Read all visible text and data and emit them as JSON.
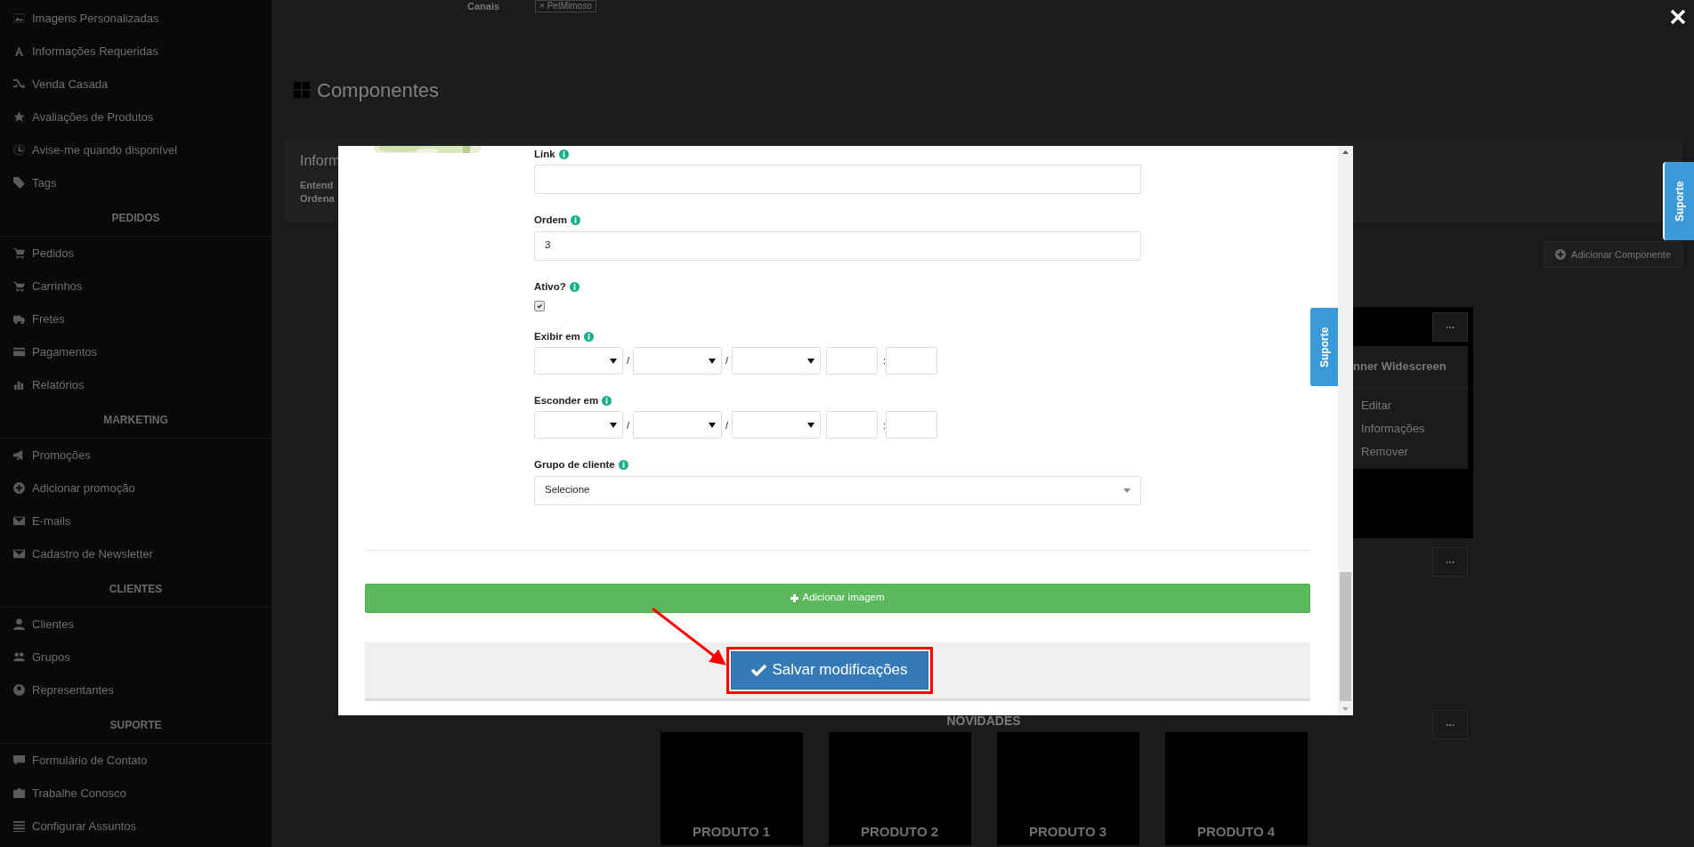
{
  "sidebar": {
    "groups": [
      {
        "items": [
          "Imagens Personalizadas",
          "Informações Requeridas",
          "Venda Casada",
          "Avaliações de Produtos",
          "Avise-me quando disponível",
          "Tags"
        ]
      },
      {
        "heading": "PEDIDOS",
        "items": [
          "Pedidos",
          "Carrinhos",
          "Fretes",
          "Pagamentos",
          "Relatórios"
        ]
      },
      {
        "heading": "MARKETING",
        "items": [
          "Promoções",
          "Adicionar promoção",
          "E-mails",
          "Cadastro de Newsletter"
        ]
      },
      {
        "heading": "CLIENTES",
        "items": [
          "Clientes",
          "Grupos",
          "Representantes"
        ]
      },
      {
        "heading": "SUPORTE",
        "items": [
          "Formulário de Contato",
          "Trabalhe Conosco",
          "Configurar Assuntos"
        ]
      }
    ]
  },
  "page": {
    "channels_label": "Canais",
    "channel_tag": "× PetMimoso",
    "title": "Componentes",
    "info": {
      "title": "Inform",
      "lines": [
        "Entend",
        "Ordena"
      ]
    },
    "add_component": "Adicionar Componente",
    "support_tab": "Suporte",
    "blocks": [
      {
        "kind": "banner",
        "more": "...",
        "card_title": "nner Widescreen",
        "menu": [
          "Editar",
          "Informações",
          "Remover"
        ]
      },
      {
        "kind": "empty",
        "more": "..."
      },
      {
        "kind": "showcase",
        "more": "...",
        "title": "NOVIDADES",
        "products": [
          "PRODUTO 1",
          "PRODUTO 2",
          "PRODUTO 3",
          "PRODUTO 4"
        ]
      }
    ]
  },
  "modal": {
    "support_tab": "Suporte",
    "fields": [
      {
        "kind": "text",
        "label": "Link"
      },
      {
        "kind": "text",
        "label": "Ordem",
        "value": "3"
      },
      {
        "kind": "checkbox",
        "label": "Ativo?",
        "checked": true
      },
      {
        "kind": "datetime",
        "label": "Exibir em",
        "separators": [
          "/",
          "/",
          ":"
        ]
      },
      {
        "kind": "datetime",
        "label": "Esconder em",
        "separators": [
          "/",
          "/",
          ":"
        ]
      },
      {
        "kind": "select",
        "label": "Grupo de cliente",
        "value": "Selecione"
      }
    ],
    "add_image": "Adicionar imagem",
    "save": "Salvar modificações"
  }
}
